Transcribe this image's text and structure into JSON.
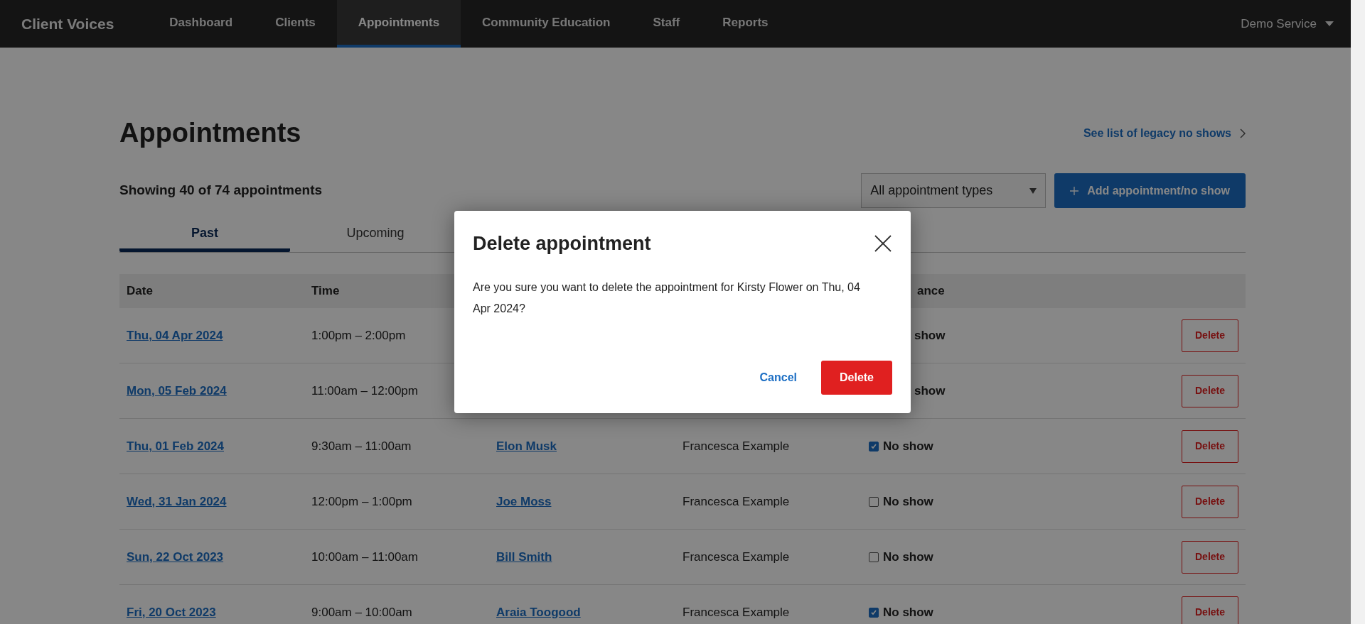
{
  "nav": {
    "brand": "Client Voices",
    "items": [
      {
        "label": "Dashboard",
        "selected": false
      },
      {
        "label": "Clients",
        "selected": false
      },
      {
        "label": "Appointments",
        "selected": true
      },
      {
        "label": "Community Education",
        "selected": false
      },
      {
        "label": "Staff",
        "selected": false
      },
      {
        "label": "Reports",
        "selected": false
      }
    ],
    "account": "Demo Service"
  },
  "page": {
    "title": "Appointments",
    "legacy_link": "See list of legacy no shows",
    "summary": "Showing 40 of 74 appointments",
    "filter": "All appointment types",
    "add_button": "Add appointment/no show"
  },
  "tabs": [
    {
      "label": "Past",
      "selected": true
    },
    {
      "label": "Upcoming",
      "selected": false
    }
  ],
  "table": {
    "columns": [
      {
        "label": "Date",
        "kind": "date"
      },
      {
        "label": "Time",
        "kind": "time"
      },
      {
        "label": "ance",
        "kind": "attendance"
      }
    ],
    "rows": [
      {
        "date": "Thu, 04 Apr 2024",
        "time": "1:00pm – 2:00pm",
        "attendance": "show",
        "action": "Delete"
      },
      {
        "date": "Mon, 05 Feb 2024",
        "time": "11:00am – 12:00pm",
        "attendance": "show",
        "action": "Delete"
      },
      {
        "date": "Thu, 01 Feb 2024",
        "time": "9:30am – 11:00am",
        "client": "Elon Musk",
        "staff": "Francesca Example",
        "checked": true,
        "attendance": "No show",
        "action": "Delete"
      },
      {
        "date": "Wed, 31 Jan 2024",
        "time": "12:00pm – 1:00pm",
        "client": "Joe Moss",
        "staff": "Francesca Example",
        "checked": false,
        "attendance": "No show",
        "action": "Delete"
      },
      {
        "date": "Sun, 22 Oct 2023",
        "time": "10:00am – 11:00am",
        "client": "Bill Smith",
        "staff": "Francesca Example",
        "checked": false,
        "attendance": "No show",
        "action": "Delete"
      },
      {
        "date": "Fri, 20 Oct 2023",
        "time": "9:00am – 10:00am",
        "client": "Araia Toogood",
        "staff": "Francesca Example",
        "checked": true,
        "attendance": "No show",
        "action": "Delete"
      }
    ]
  },
  "modal": {
    "title": "Delete appointment",
    "message": "Are you sure you want to delete the appointment for Kirsty Flower on Thu, 04 Apr 2024?",
    "cancel": "Cancel",
    "confirm": "Delete"
  }
}
